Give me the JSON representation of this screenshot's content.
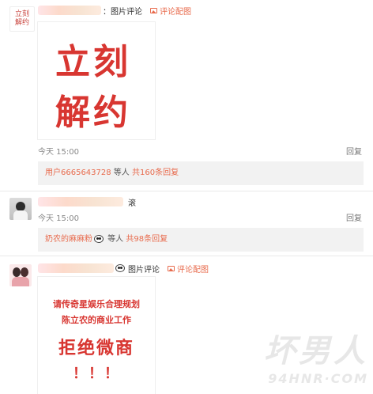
{
  "comments": [
    {
      "avatar_text": "立刻\n解约",
      "tag": "：图片评论",
      "pic_link_label": "评论配图",
      "image_text_line1": "立刻",
      "image_text_line2": "解约",
      "time": "今天 15:00",
      "reply_label": "回复",
      "subreply": {
        "user": "用户6665643728",
        "mid": " 等人 ",
        "count": "共160条回复"
      }
    },
    {
      "tag": "滚",
      "time": "今天 15:00",
      "reply_label": "回复",
      "subreply": {
        "user": "奶农的麻麻粉",
        "mid": " 等人 ",
        "count": "共98条回复"
      }
    },
    {
      "tag": "图片评论",
      "pic_link_label": "评论配图",
      "image_text_line1": "请传奇星娱乐合理规划",
      "image_text_line2": "陈立农的商业工作",
      "image_text_line3": "拒绝微商",
      "image_text_line4": "！！！"
    }
  ],
  "watermark": {
    "big": "坏男人",
    "small": "94HNR·COM"
  },
  "colors": {
    "accent": "#e86b4d",
    "red_text": "#d83631",
    "subreply_bg": "#f2f2f2"
  },
  "icons": [
    "image-icon",
    "panda-emoji-icon"
  ]
}
